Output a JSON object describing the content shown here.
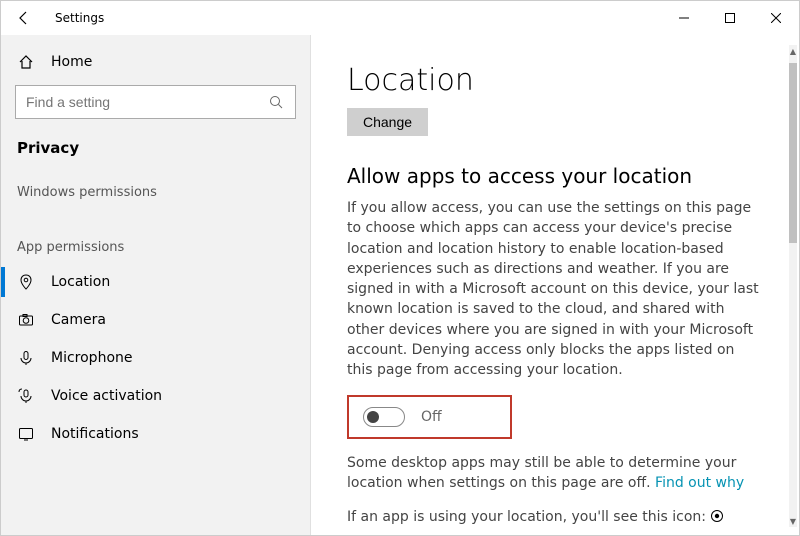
{
  "app_title": "Settings",
  "sidebar": {
    "home": "Home",
    "search_placeholder": "Find a setting",
    "category": "Privacy",
    "group1_header": "Windows permissions",
    "group2_header": "App permissions",
    "items": [
      "Location",
      "Camera",
      "Microphone",
      "Voice activation",
      "Notifications"
    ]
  },
  "main": {
    "page_heading": "Location",
    "change_label": "Change",
    "section_heading": "Allow apps to access your location",
    "section_body": "If you allow access, you can use the settings on this page to choose which apps can access your device's precise location and location history to enable location-based experiences such as directions and weather. If you are signed in with a Microsoft account on this device, your last known location is saved to the cloud, and shared with other devices where you are signed in with your Microsoft account. Denying access only blocks the apps listed on this page from accessing your location.",
    "toggle_label": "Off",
    "desktop_note_a": "Some desktop apps may still be able to determine your location when settings on this page are off. ",
    "desktop_note_link": "Find out why",
    "in_use_note": "If an app is using your location, you'll see this icon: "
  }
}
